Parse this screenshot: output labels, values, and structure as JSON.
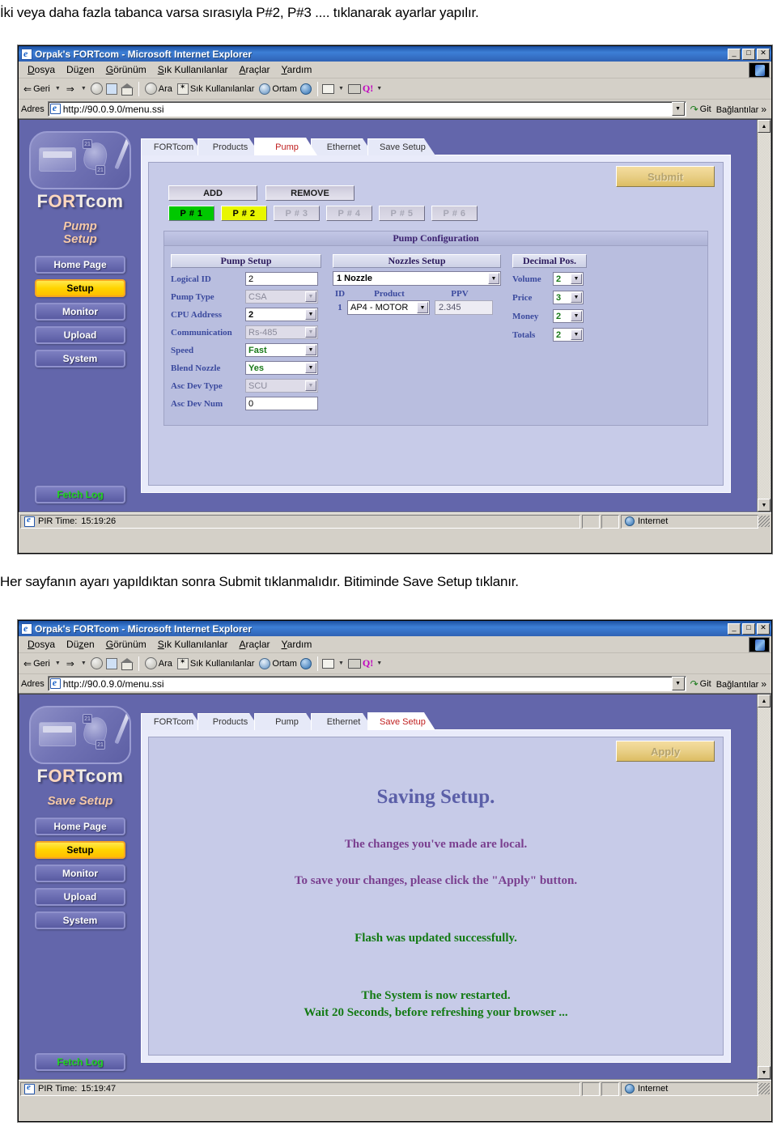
{
  "captions": {
    "top": "İki veya daha fazla tabanca varsa sırasıyla P#2, P#3 .... tıklanarak ayarlar yapılır.",
    "middle": "Her sayfanın ayarı yapıldıktan sonra Submit tıklanmalıdır. Bitiminde Save Setup tıklanır."
  },
  "browser": {
    "title": "Orpak's FORTcom - Microsoft Internet Explorer",
    "window_controls": {
      "minimize": "_",
      "maximize": "□",
      "close": "✕"
    },
    "menu": [
      {
        "label": "Dosya",
        "mnemonic": "D"
      },
      {
        "label": "Düzen",
        "mnemonic": "z"
      },
      {
        "label": "Görünüm",
        "mnemonic": "G"
      },
      {
        "label": "Sık Kullanılanlar",
        "mnemonic": "S"
      },
      {
        "label": "Araçlar",
        "mnemonic": "A"
      },
      {
        "label": "Yardım",
        "mnemonic": "Y"
      }
    ],
    "toolbar": {
      "back": "Geri",
      "forward": "",
      "stop": "stop-icon",
      "refresh": "refresh-icon",
      "home": "home-icon",
      "search": "Ara",
      "favorites": "Sık Kullanılanlar",
      "media": "Ortam",
      "history": "history-icon",
      "mail": "mail-icon",
      "print": "print-icon",
      "messenger": "Q!"
    },
    "address": {
      "label": "Adres",
      "url": "http://90.0.9.0/menu.ssi",
      "go": "Git",
      "links": "Bağlantılar"
    },
    "status": {
      "pir_label": "PIR Time:",
      "zone": "Internet"
    }
  },
  "app": {
    "logo": "FORTcom",
    "nav": [
      {
        "label": "Home Page",
        "active": false
      },
      {
        "label": "Setup",
        "active": true
      },
      {
        "label": "Monitor",
        "active": false
      },
      {
        "label": "Upload",
        "active": false
      },
      {
        "label": "System",
        "active": false
      }
    ],
    "fetch_log": "Fetch Log",
    "tabs": [
      "FORTcom",
      "Products",
      "Pump",
      "Ethernet",
      "Save Setup"
    ]
  },
  "window1": {
    "subtitle_line1": "Pump",
    "subtitle_line2": "Setup",
    "active_tab": "Pump",
    "status_time": "15:19:26",
    "submit_label": "Submit",
    "add_label": "ADD",
    "remove_label": "REMOVE",
    "pumps": [
      {
        "label": "P # 1",
        "state": "green"
      },
      {
        "label": "P # 2",
        "state": "yellow"
      },
      {
        "label": "P # 3",
        "state": "off"
      },
      {
        "label": "P # 4",
        "state": "off"
      },
      {
        "label": "P # 5",
        "state": "off"
      },
      {
        "label": "P # 6",
        "state": "off"
      }
    ],
    "config_title": "Pump Configuration",
    "pump_setup": {
      "header": "Pump Setup",
      "fields": [
        {
          "label": "Logical ID",
          "value": "2",
          "type": "text",
          "disabled": false,
          "green": false,
          "bold": false
        },
        {
          "label": "Pump Type",
          "value": "CSA",
          "type": "select",
          "disabled": true,
          "green": false,
          "bold": false
        },
        {
          "label": "CPU Address",
          "value": "2",
          "type": "select",
          "disabled": false,
          "green": false,
          "bold": true
        },
        {
          "label": "Communication",
          "value": "Rs-485",
          "type": "select",
          "disabled": true,
          "green": false,
          "bold": false
        },
        {
          "label": "Speed",
          "value": "Fast",
          "type": "select",
          "disabled": false,
          "green": true,
          "bold": true
        },
        {
          "label": "Blend Nozzle",
          "value": "Yes",
          "type": "select",
          "disabled": false,
          "green": true,
          "bold": true
        },
        {
          "label": "Asc Dev Type",
          "value": "SCU",
          "type": "select",
          "disabled": true,
          "green": false,
          "bold": false
        },
        {
          "label": "Asc Dev Num",
          "value": "0",
          "type": "text",
          "disabled": false,
          "green": false,
          "bold": false
        }
      ]
    },
    "nozzles_setup": {
      "header": "Nozzles Setup",
      "count_value": "1 Nozzle",
      "columns": [
        "ID",
        "Product",
        "PPV"
      ],
      "rows": [
        {
          "id": "1",
          "product": "AP4 - MOTOR",
          "ppv": "2.345"
        }
      ]
    },
    "decimal_pos": {
      "header": "Decimal Pos.",
      "rows": [
        {
          "label": "Volume",
          "value": "2"
        },
        {
          "label": "Price",
          "value": "3"
        },
        {
          "label": "Money",
          "value": "2"
        },
        {
          "label": "Totals",
          "value": "2"
        }
      ]
    }
  },
  "window2": {
    "subtitle_line1": "Save Setup",
    "subtitle_line2": "",
    "active_tab": "Save Setup",
    "status_time": "15:19:47",
    "apply_label": "Apply",
    "heading": "Saving Setup.",
    "messages": [
      {
        "text": "The changes you've made are local.",
        "color": "purple"
      },
      {
        "text": "To save your changes, please click the \"Apply\" button.",
        "color": "purple"
      },
      {
        "text": "Flash was updated successfully.",
        "color": "green"
      },
      {
        "text": "The System is now restarted.",
        "color": "green"
      },
      {
        "text": "Wait 20 Seconds, before refreshing your browser ...",
        "color": "green"
      }
    ]
  },
  "colors": {
    "sidebar_bg": "#6366ab",
    "panel_bg": "#c7cbe8",
    "accent_yellow": "#ffd400",
    "pump_green": "#00c800",
    "pump_yellow": "#e8f600",
    "titlebar_blue": "#1b4fa0",
    "msg_purple": "#7a3f8f",
    "msg_green": "#137a13"
  }
}
